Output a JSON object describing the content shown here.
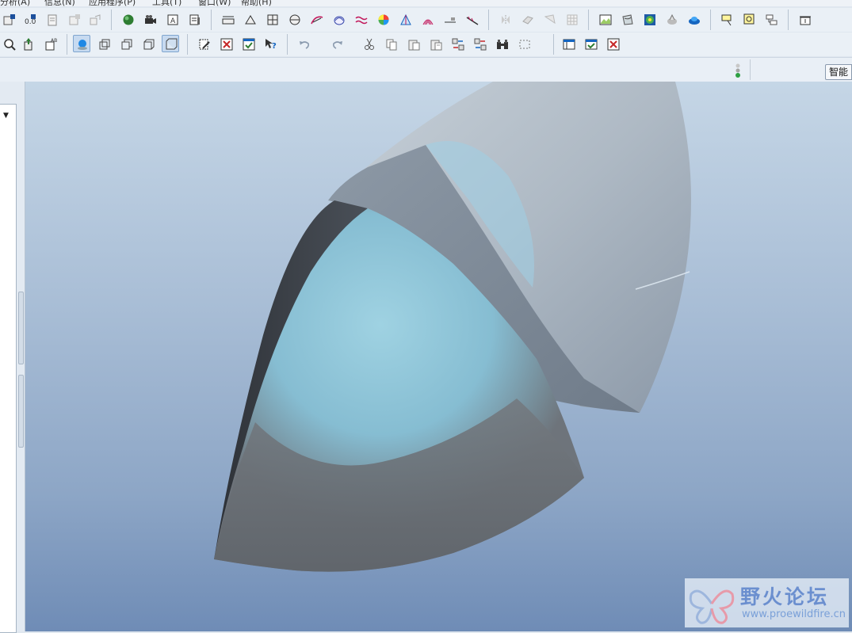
{
  "menu": {
    "items": [
      "分析(A)",
      "信息(N)",
      "应用程序(P)",
      "工具(T)",
      "窗口(W)",
      "帮助(H)"
    ]
  },
  "status": {
    "smart_filter_label": "智能"
  },
  "watermark": {
    "title": "野火论坛",
    "url": "www.proewildfire.cn"
  },
  "colors": {
    "viewport_top": "#c5d6e6",
    "viewport_bottom": "#6f8cb6",
    "model_cyan": "#8fc3d6",
    "model_gray": "#6b7076"
  }
}
